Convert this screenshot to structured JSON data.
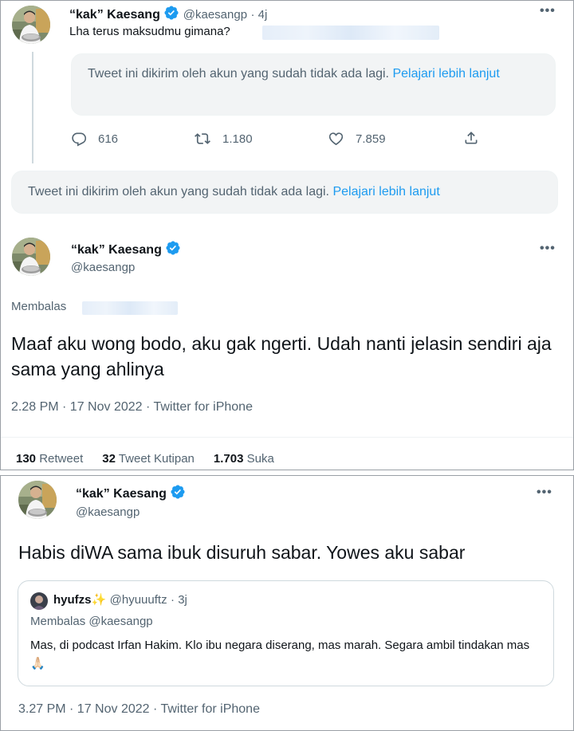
{
  "tweet1": {
    "name": "“kak” Kaesang",
    "handle": "@kaesangp",
    "time": "· 4j",
    "text": "Lha terus maksudmu gimana?",
    "notice_text": "Tweet ini dikirim oleh akun yang sudah tidak ada lagi.",
    "notice_link": "Pelajari lebih lanjut",
    "replies": "616",
    "retweets": "1.180",
    "likes": "7.859"
  },
  "deleted_tweet": {
    "notice_text": "Tweet ini dikirim oleh akun yang sudah tidak ada lagi.",
    "notice_link": "Pelajari lebih lanjut"
  },
  "tweet2": {
    "name": "“kak” Kaesang",
    "handle": "@kaesangp",
    "replying_label": "Membalas",
    "text": "Maaf aku wong bodo, aku gak ngerti. Udah nanti jelasin sendiri aja sama yang ahlinya",
    "meta": "2.28 PM · 17 Nov 2022 · Twitter for iPhone",
    "retweet_count": "130",
    "retweet_label": "Retweet",
    "quote_count": "32",
    "quote_label": "Tweet Kutipan",
    "like_count": "1.703",
    "like_label": "Suka"
  },
  "tweet3": {
    "name": "“kak” Kaesang",
    "handle": "@kaesangp",
    "text": "Habis diWA sama ibuk disuruh sabar. Yowes aku sabar",
    "meta": "3.27 PM · 17 Nov 2022 · Twitter for iPhone",
    "quoted": {
      "name": "hyufzs✨",
      "handle": "@hyuuuftz",
      "time": "· 3j",
      "replying": "Membalas @kaesangp",
      "text": "Mas, di podcast Irfan Hakim. Klo ibu negara diserang, mas marah. Segara ambil tindakan mas 🙏🏻"
    }
  },
  "more_label": "•••",
  "colors": {
    "link": "#1d9bf0",
    "verified": "#1d9bf0",
    "secondary_text": "#536471",
    "notice_bg": "#f2f4f5"
  },
  "icons": [
    "reply-icon",
    "retweet-icon",
    "like-icon",
    "share-icon",
    "verified-icon",
    "more-icon"
  ]
}
